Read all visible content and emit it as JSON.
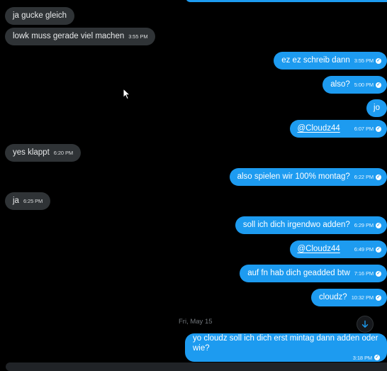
{
  "colors": {
    "background": "#000000",
    "incoming_bubble": "#2f3336",
    "outgoing_bubble": "#1d9bf0",
    "text": "#e7e9ea",
    "muted": "#71767b"
  },
  "messages": [
    {
      "id": "m1",
      "dir": "in",
      "text": "ja gucke gleich",
      "time": ""
    },
    {
      "id": "m2",
      "dir": "in",
      "text": "lowk muss gerade viel machen",
      "time": "3:55 PM"
    },
    {
      "id": "m3",
      "dir": "out",
      "text": "ez ez schreib dann",
      "time": "3:55 PM"
    },
    {
      "id": "m4",
      "dir": "out",
      "text": "also?",
      "time": "5:00 PM"
    },
    {
      "id": "m5",
      "dir": "out",
      "text": "jo",
      "time": ""
    },
    {
      "id": "m6",
      "dir": "out",
      "text": "@Cloudz44",
      "time": "6:07 PM",
      "mention": true
    },
    {
      "id": "m7",
      "dir": "in",
      "text": "yes klappt",
      "time": "6:20 PM"
    },
    {
      "id": "m8",
      "dir": "out",
      "text": "also spielen wir 100% montag?",
      "time": "6:22 PM"
    },
    {
      "id": "m9",
      "dir": "in",
      "text": "ja",
      "time": "6:25 PM"
    },
    {
      "id": "m10",
      "dir": "out",
      "text": "soll ich dich irgendwo adden?",
      "time": "6:29 PM"
    },
    {
      "id": "m11",
      "dir": "out",
      "text": "@Cloudz44",
      "time": "6:49 PM",
      "mention": true
    },
    {
      "id": "m12",
      "dir": "out",
      "text": "auf fn hab dich geadded btw",
      "time": "7:16 PM"
    },
    {
      "id": "m13",
      "dir": "out",
      "text": "cloudz?",
      "time": "10:32 PM"
    },
    {
      "id": "m14",
      "dir": "out",
      "text": "yo cloudz soll ich dich erst mintag dann adden oder wie?",
      "time": "3:18 PM"
    }
  ],
  "date_separator": "Fri, May 15",
  "scroll_button": {
    "icon": "arrow-down-icon"
  },
  "checkmark_glyph": "✓",
  "cursor": {
    "icon": "mouse-pointer-icon"
  }
}
